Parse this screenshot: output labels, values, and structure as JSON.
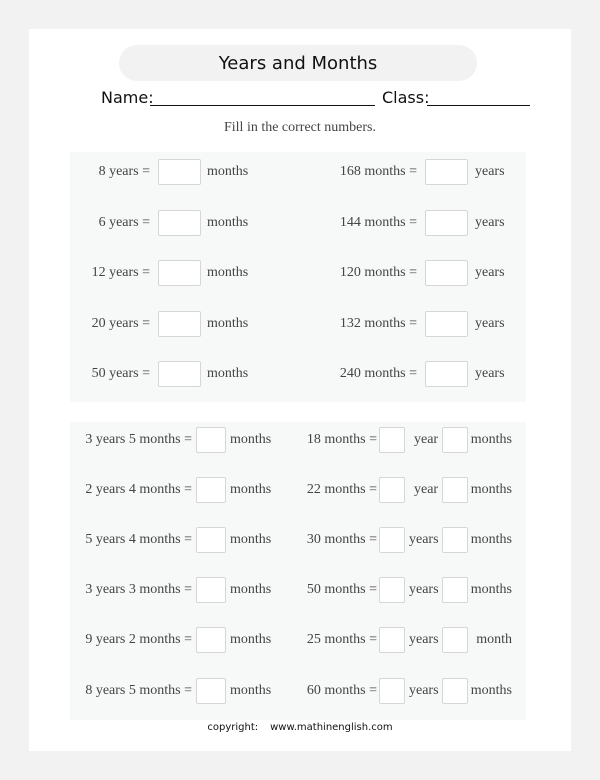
{
  "header": {
    "title": "Years and Months",
    "name_label": "Name:",
    "class_label": "Class:",
    "instruction": "Fill in the correct numbers."
  },
  "section1": {
    "left": [
      {
        "prompt": "8 years =",
        "unit": "months"
      },
      {
        "prompt": "6 years =",
        "unit": "months"
      },
      {
        "prompt": "12 years =",
        "unit": "months"
      },
      {
        "prompt": "20 years =",
        "unit": "months"
      },
      {
        "prompt": "50 years =",
        "unit": "months"
      }
    ],
    "right": [
      {
        "prompt": "168 months =",
        "unit": "years"
      },
      {
        "prompt": "144 months =",
        "unit": "years"
      },
      {
        "prompt": "120 months =",
        "unit": "years"
      },
      {
        "prompt": "132 months =",
        "unit": "years"
      },
      {
        "prompt": "240 months =",
        "unit": "years"
      }
    ]
  },
  "section2": {
    "left": [
      {
        "prompt": "3 years 5 months =",
        "unit": "months"
      },
      {
        "prompt": "2 years 4 months =",
        "unit": "months"
      },
      {
        "prompt": "5 years 4 months =",
        "unit": "months"
      },
      {
        "prompt": "3 years 3 months =",
        "unit": "months"
      },
      {
        "prompt": "9 years 2 months =",
        "unit": "months"
      },
      {
        "prompt": "8 years 5 months =",
        "unit": "months"
      }
    ],
    "right": [
      {
        "prompt": "18 months =",
        "unit1": "year",
        "unit2": "months"
      },
      {
        "prompt": "22 months =",
        "unit1": "year",
        "unit2": "months"
      },
      {
        "prompt": "30 months =",
        "unit1": "years",
        "unit2": "months"
      },
      {
        "prompt": "50 months =",
        "unit1": "years",
        "unit2": "months"
      },
      {
        "prompt": "25 months =",
        "unit1": "years",
        "unit2": "month"
      },
      {
        "prompt": "60 months =",
        "unit1": "years",
        "unit2": "months"
      }
    ]
  },
  "footer": {
    "copyright_label": "copyright:",
    "website": "www.mathinenglish.com"
  }
}
